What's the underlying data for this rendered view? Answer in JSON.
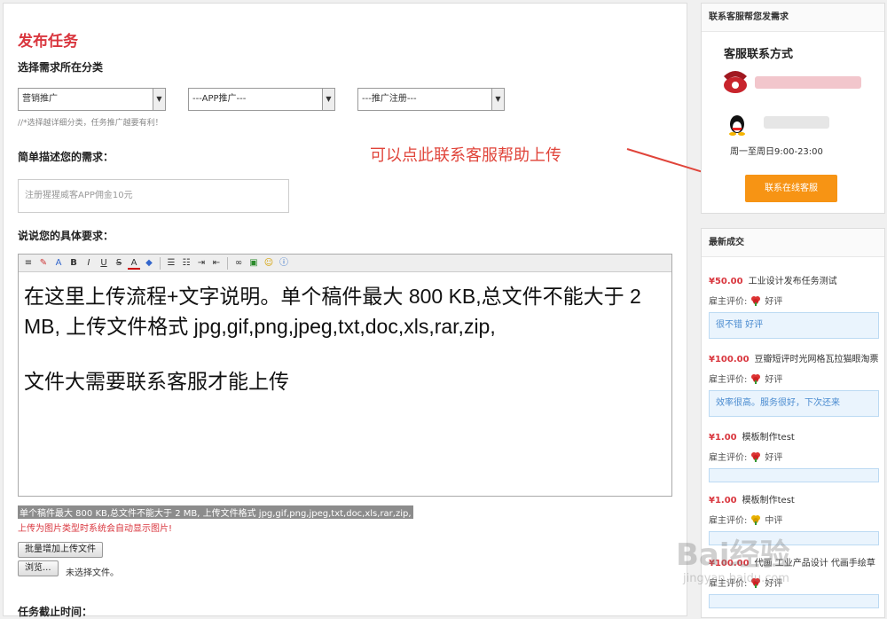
{
  "page": {
    "title": "发布任务",
    "category_label": "选择需求所在分类",
    "category_selects": [
      "营销推广",
      "---APP推广---",
      "---推广注册---"
    ],
    "category_hint": "//*选择越详细分类，任务推广越要有利！",
    "desc_label": "简单描述您的需求：",
    "desc_placeholder": "注册猩猩威客APP佣金10元",
    "detail_label": "说说您的具体要求：",
    "editor_lines": [
      "在这里上传流程+文字说明。单个稿件最大 800 KB,总文件不能大于 2 MB, 上传文件格式 jpg,gif,png,jpeg,txt,doc,xls,rar,zip,",
      "文件大需要联系客服才能上传"
    ],
    "upload_rules": "单个稿件最大 800 KB,总文件不能大于 2 MB, 上传文件格式 jpg,gif,png,jpeg,txt,doc,xls,rar,zip,",
    "upload_notice": "上传为图片类型时系统会自动显示图片!",
    "batch_upload_button": "批量增加上传文件",
    "browse_button": "浏览...",
    "file_status": "未选择文件。",
    "deadline_label": "任务截止时间：",
    "annotation": "可以点此联系客服帮助上传"
  },
  "sidebar": {
    "contact": {
      "title": "联系客服帮您发需求",
      "heading": "客服联系方式",
      "hours": "周一至周日9:00-23:00",
      "online_button": "联系在线客服"
    },
    "deals": {
      "title": "最新成交",
      "rating_label": "雇主评价:",
      "items": [
        {
          "price": "¥50.00",
          "name": "工业设计发布任务测试",
          "rating": "好评",
          "comment": "很不错 好评"
        },
        {
          "price": "¥100.00",
          "name": "豆瓣短评时光网格瓦拉猫眼淘票",
          "rating": "好评",
          "comment": "效率很高。服务很好，下次还来"
        },
        {
          "price": "¥1.00",
          "name": "模板制作test",
          "rating": "好评",
          "comment": ""
        },
        {
          "price": "¥1.00",
          "name": "模板制作test",
          "rating": "中评",
          "comment": ""
        },
        {
          "price": "¥100.00",
          "name": "代画 工业产品设计 代画手绘草",
          "rating": "好评",
          "comment": ""
        }
      ]
    }
  },
  "watermark": {
    "main": "Bai经验",
    "sub": "jingyan.baidu.com"
  },
  "colors": {
    "accent_red": "#d9363e",
    "online_button": "#f79414",
    "comment_box": "#eaf4fd"
  }
}
